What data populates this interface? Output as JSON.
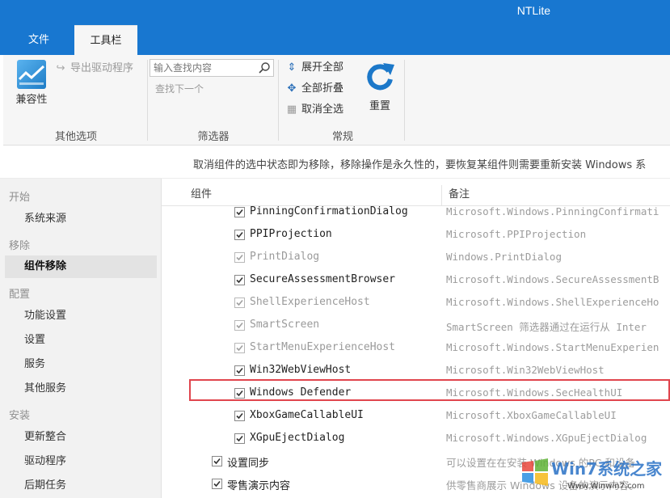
{
  "app": {
    "title": "NTLite"
  },
  "tabs": [
    {
      "label": "文件",
      "active": false
    },
    {
      "label": "工具栏",
      "active": true
    }
  ],
  "ribbon": {
    "groups": {
      "other": {
        "label": "其他选项",
        "compat_label": "兼容性",
        "export_drivers_label": "导出驱动程序"
      },
      "filter": {
        "label": "筛选器",
        "search_placeholder": "输入查找内容",
        "find_next_label": "查找下一个"
      },
      "general": {
        "label": "常规",
        "expand_all_label": "展开全部",
        "collapse_all_label": "全部折叠",
        "deselect_all_label": "取消全选",
        "reset_label": "重置"
      }
    }
  },
  "info_text": "取消组件的选中状态即为移除，移除操作是永久性的，要恢复某组件则需要重新安装 Windows 系",
  "sidebar": {
    "sections": [
      {
        "title": "开始",
        "items": [
          {
            "label": "系统来源",
            "active": false
          }
        ]
      },
      {
        "title": "移除",
        "items": [
          {
            "label": "组件移除",
            "active": true
          }
        ]
      },
      {
        "title": "配置",
        "items": [
          {
            "label": "功能设置",
            "active": false
          },
          {
            "label": "设置",
            "active": false
          },
          {
            "label": "服务",
            "active": false
          },
          {
            "label": "其他服务",
            "active": false
          }
        ]
      },
      {
        "title": "安装",
        "items": [
          {
            "label": "更新整合",
            "active": false
          },
          {
            "label": "驱动程序",
            "active": false
          },
          {
            "label": "后期任务",
            "active": false
          }
        ]
      }
    ]
  },
  "table": {
    "columns": [
      "组件",
      "备注"
    ],
    "rows": [
      {
        "name": "PinningConfirmationDialog",
        "note": "Microsoft.Windows.PinningConfirmati",
        "checked": true,
        "dim": false,
        "level": 2
      },
      {
        "name": "PPIProjection",
        "note": "Microsoft.PPIProjection",
        "checked": true,
        "dim": false,
        "level": 2
      },
      {
        "name": "PrintDialog",
        "note": "Windows.PrintDialog",
        "checked": true,
        "dim": true,
        "level": 2
      },
      {
        "name": "SecureAssessmentBrowser",
        "note": "Microsoft.Windows.SecureAssessmentB",
        "checked": true,
        "dim": false,
        "level": 2
      },
      {
        "name": "ShellExperienceHost",
        "note": "Microsoft.Windows.ShellExperienceHo",
        "checked": true,
        "dim": true,
        "level": 2
      },
      {
        "name": "SmartScreen",
        "note": "SmartScreen 筛选器通过在运行从 Inter",
        "checked": true,
        "dim": true,
        "level": 2
      },
      {
        "name": "StartMenuExperienceHost",
        "note": "Microsoft.Windows.StartMenuExperien",
        "checked": true,
        "dim": true,
        "level": 2
      },
      {
        "name": "Win32WebViewHost",
        "note": "Microsoft.Win32WebViewHost",
        "checked": true,
        "dim": false,
        "level": 2
      },
      {
        "name": "Windows Defender",
        "note": "Microsoft.Windows.SecHealthUI",
        "checked": true,
        "dim": false,
        "level": 2,
        "highlighted": true
      },
      {
        "name": "XboxGameCallableUI",
        "note": "Microsoft.XboxGameCallableUI",
        "checked": true,
        "dim": false,
        "level": 2
      },
      {
        "name": "XGpuEjectDialog",
        "note": "Microsoft.Windows.XGpuEjectDialog",
        "checked": true,
        "dim": false,
        "level": 2
      },
      {
        "name": "设置同步",
        "note": "可以设置在在安装 Windows 的PC 和设备",
        "checked": true,
        "dim": false,
        "level": 1
      },
      {
        "name": "零售演示内容",
        "note": "供零售商展示 Windows 设备的演示内容。",
        "checked": true,
        "dim": false,
        "level": 1
      }
    ]
  },
  "watermark": {
    "brand": "Win7系统之家",
    "url": "Www.Winwin7.com"
  },
  "colors": {
    "accent": "#1877d0",
    "highlight_border": "#e0454d"
  }
}
